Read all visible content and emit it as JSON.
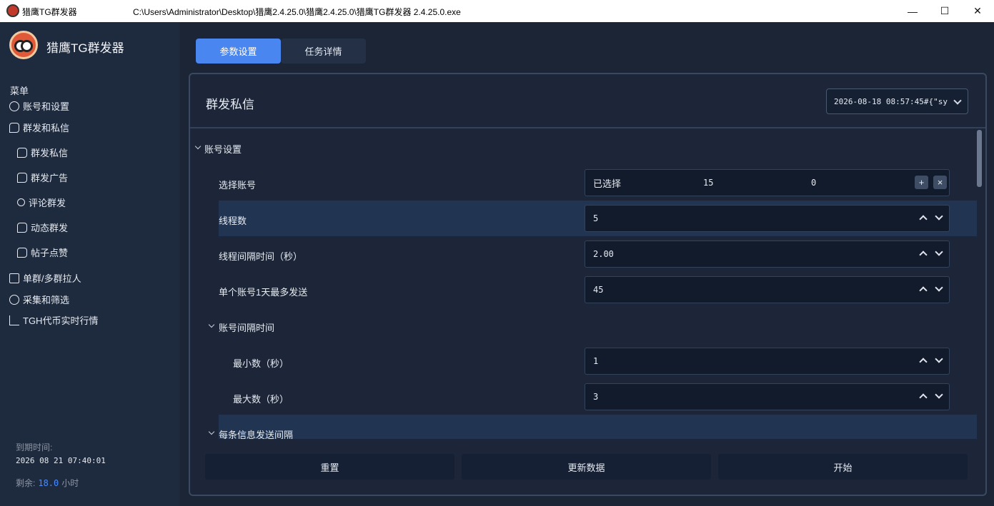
{
  "window": {
    "app_title": "猎鹰TG群发器",
    "path": "C:\\Users\\Administrator\\Desktop\\猎鹰2.4.25.0\\猎鹰2.4.25.0\\猎鹰TG群发器 2.4.25.0.exe",
    "min": "—",
    "max": "☐",
    "close": "✕"
  },
  "sidebar": {
    "app_name": "猎鹰TG群发器",
    "menu_title": "菜单",
    "items": [
      {
        "label": "账号和设置"
      },
      {
        "label": "群发和私信"
      },
      {
        "label": "群发私信"
      },
      {
        "label": "群发广告"
      },
      {
        "label": "评论群发"
      },
      {
        "label": "动态群发"
      },
      {
        "label": "帖子点赞"
      },
      {
        "label": "单群/多群拉人"
      },
      {
        "label": "采集和筛选"
      },
      {
        "label": "TGH代币实时行情"
      }
    ],
    "expire_label": "到期时间:",
    "expire_value": "2026 08 21 07:40:01",
    "remain_label": "剩余:",
    "remain_value": "18.0",
    "remain_unit": "小时"
  },
  "tabs": [
    {
      "label": "参数设置"
    },
    {
      "label": "任务详情"
    }
  ],
  "panel": {
    "title": "群发私信",
    "date_select_value": "2026-08-18 08:57:45#{\"sy",
    "section_account": "账号设置",
    "select_account": {
      "label": "选择账号",
      "selected_label": "已选择",
      "selected_count": "15",
      "other_count": "0",
      "add": "+",
      "remove": "×"
    },
    "threads": {
      "label": "线程数",
      "value": "5"
    },
    "thread_interval": {
      "label": "线程间隔时间（秒）",
      "value": "2.00"
    },
    "max_per_day": {
      "label": "单个账号1天最多发送",
      "value": "45"
    },
    "account_interval": {
      "label": "账号间隔时间"
    },
    "min_sec": {
      "label": "最小数（秒）",
      "value": "1"
    },
    "max_sec": {
      "label": "最大数（秒）",
      "value": "3"
    },
    "msg_interval": {
      "label": "每条信息发送间隔"
    }
  },
  "buttons": {
    "reset": "重置",
    "refresh": "更新数据",
    "start": "开始"
  }
}
